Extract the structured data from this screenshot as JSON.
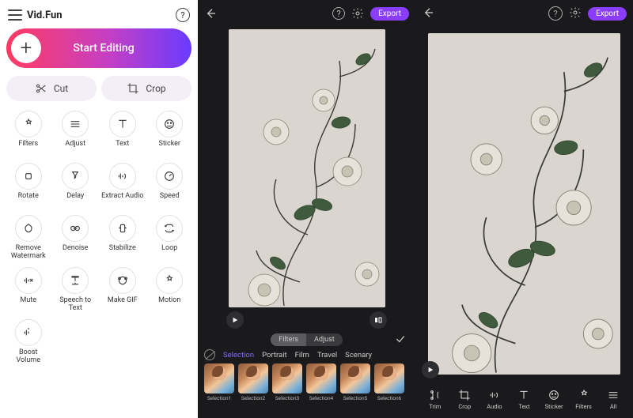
{
  "brand": "Vid.Fun",
  "cta_label": "Start Editing",
  "pill_cut": "Cut",
  "pill_crop": "Crop",
  "tools": [
    {
      "name": "filters",
      "label": "Filters"
    },
    {
      "name": "adjust",
      "label": "Adjust"
    },
    {
      "name": "text",
      "label": "Text"
    },
    {
      "name": "sticker",
      "label": "Sticker"
    },
    {
      "name": "rotate",
      "label": "Rotate"
    },
    {
      "name": "delay",
      "label": "Delay"
    },
    {
      "name": "extract-audio",
      "label": "Extract Audio"
    },
    {
      "name": "speed",
      "label": "Speed"
    },
    {
      "name": "remove-watermark",
      "label": "Remove Watermark"
    },
    {
      "name": "denoise",
      "label": "Denoise"
    },
    {
      "name": "stabilize",
      "label": "Stabilize"
    },
    {
      "name": "loop",
      "label": "Loop"
    },
    {
      "name": "mute",
      "label": "Mute"
    },
    {
      "name": "speech-to-text",
      "label": "Speech to Text"
    },
    {
      "name": "make-gif",
      "label": "Make GIF"
    },
    {
      "name": "motion",
      "label": "Motion"
    },
    {
      "name": "boost-volume",
      "label": "Boost Volume"
    }
  ],
  "export_label": "Export",
  "seg": {
    "filters": "Filters",
    "adjust": "Adjust"
  },
  "cats": [
    "Selection",
    "Portrait",
    "Film",
    "Travel",
    "Scenary"
  ],
  "thumbs": [
    "Selection1",
    "Selection2",
    "Selection3",
    "Selection4",
    "Selection5",
    "Selection6"
  ],
  "bottom": [
    {
      "name": "trim",
      "label": "Trim"
    },
    {
      "name": "crop",
      "label": "Crop"
    },
    {
      "name": "audio",
      "label": "Audio"
    },
    {
      "name": "text",
      "label": "Text"
    },
    {
      "name": "sticker",
      "label": "Sticker"
    },
    {
      "name": "filters",
      "label": "Filters"
    },
    {
      "name": "all",
      "label": "All"
    }
  ]
}
